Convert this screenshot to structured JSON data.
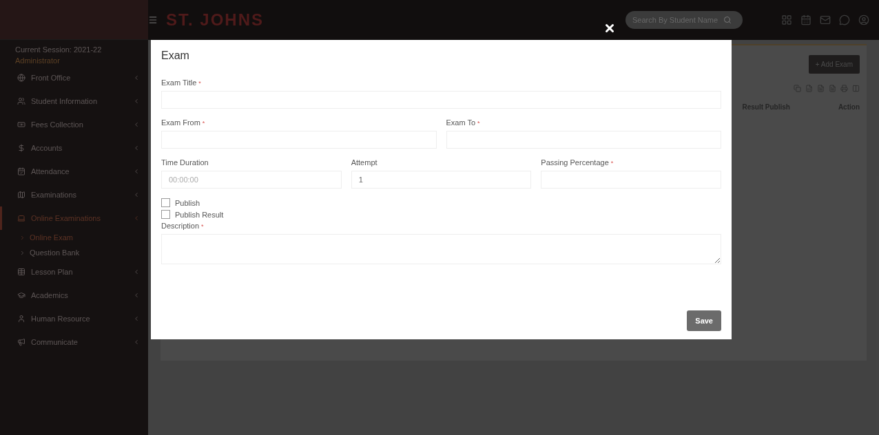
{
  "header": {
    "brand": "ST. JOHNS",
    "search": {
      "placeholder": "Search By Student Name"
    }
  },
  "sidebar": {
    "session": "Current Session: 2021-22",
    "role": "Administrator",
    "items": [
      {
        "label": "Front Office",
        "selected": false
      },
      {
        "label": "Student Information",
        "selected": false
      },
      {
        "label": "Fees Collection",
        "selected": false
      },
      {
        "label": "Accounts",
        "selected": false
      },
      {
        "label": "Attendance",
        "selected": false
      },
      {
        "label": "Examinations",
        "selected": false
      },
      {
        "label": "Online Examinations",
        "selected": true,
        "children": [
          {
            "label": "Online Exam",
            "selected": true
          },
          {
            "label": "Question Bank",
            "selected": false
          }
        ]
      },
      {
        "label": "Lesson Plan",
        "selected": false
      },
      {
        "label": "Academics",
        "selected": false
      },
      {
        "label": "Human Resource",
        "selected": false
      },
      {
        "label": "Communicate",
        "selected": false
      }
    ]
  },
  "background_panel": {
    "add_button": "+ Add Exam",
    "columns": [
      "Result Publish",
      "Action"
    ]
  },
  "modal": {
    "title": "Exam",
    "fields": [
      {
        "kind": "text",
        "label": "Exam Title",
        "required_mark": "*"
      },
      {
        "kind": "text",
        "label": "Exam From",
        "required_mark": "*"
      },
      {
        "kind": "text",
        "label": "Exam To",
        "required_mark": "*"
      },
      {
        "kind": "text",
        "label": "Time Duration",
        "placeholder": "00:00:00"
      },
      {
        "kind": "text",
        "label": "Attempt",
        "value": "1"
      },
      {
        "kind": "text",
        "label": "Passing Percentage",
        "required_mark": "*"
      },
      {
        "kind": "checkbox",
        "label": "Publish",
        "checked": false
      },
      {
        "kind": "checkbox",
        "label": "Publish Result",
        "checked": false
      },
      {
        "kind": "textarea",
        "label": "Description",
        "required_mark": "*"
      }
    ],
    "save_button": "Save"
  }
}
